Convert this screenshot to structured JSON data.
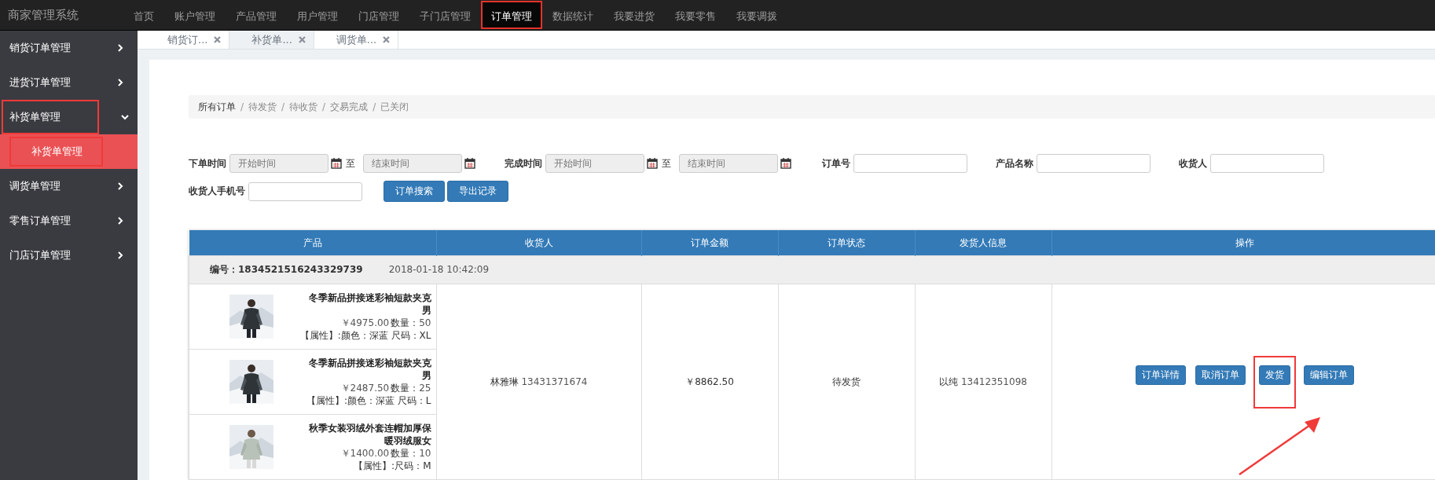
{
  "brand": "商家管理系统",
  "nav": [
    {
      "label": "首页",
      "selected": false,
      "highlighted": false
    },
    {
      "label": "账户管理",
      "selected": false,
      "highlighted": false
    },
    {
      "label": "产品管理",
      "selected": false,
      "highlighted": false
    },
    {
      "label": "用户管理",
      "selected": false,
      "highlighted": false
    },
    {
      "label": "门店管理",
      "selected": false,
      "highlighted": false
    },
    {
      "label": "子门店管理",
      "selected": false,
      "highlighted": false
    },
    {
      "label": "订单管理",
      "selected": true,
      "highlighted": true
    },
    {
      "label": "数据统计",
      "selected": false,
      "highlighted": false
    },
    {
      "label": "我要进货",
      "selected": false,
      "highlighted": false
    },
    {
      "label": "我要零售",
      "selected": false,
      "highlighted": false
    },
    {
      "label": "我要调拨",
      "selected": false,
      "highlighted": false
    }
  ],
  "sidebar": {
    "items": [
      {
        "label": "销货订单管理",
        "expanded": false,
        "highlighted": false
      },
      {
        "label": "进货订单管理",
        "expanded": false,
        "highlighted": false
      },
      {
        "label": "补货单管理",
        "expanded": true,
        "highlighted": true,
        "children": [
          {
            "label": "补货单管理",
            "selected": true,
            "highlighted": true
          }
        ]
      },
      {
        "label": "调货单管理",
        "expanded": false,
        "highlighted": false
      },
      {
        "label": "零售订单管理",
        "expanded": false,
        "highlighted": false
      },
      {
        "label": "门店订单管理",
        "expanded": false,
        "highlighted": false
      }
    ]
  },
  "tabs": [
    {
      "label": "销货订...",
      "selected": false
    },
    {
      "label": "补货单...",
      "selected": true
    },
    {
      "label": "调货单...",
      "selected": false
    }
  ],
  "breadcrumb": [
    {
      "label": "所有订单",
      "selected": true
    },
    {
      "separator": "/",
      "label": "待发货",
      "selected": false
    },
    {
      "separator": "/",
      "label": "待收货",
      "selected": false
    },
    {
      "separator": "/",
      "label": "交易完成",
      "selected": false
    },
    {
      "separator": "/",
      "label": "已关闭",
      "selected": false
    }
  ],
  "filters": {
    "order_time": {
      "label": "下单时间",
      "start_placeholder": "开始时间",
      "to": "至",
      "end_placeholder": "结束时间"
    },
    "finish_time": {
      "label": "完成时间",
      "start_placeholder": "开始时间",
      "to": "至",
      "end_placeholder": "结束时间"
    },
    "order_no": {
      "label": "订单号"
    },
    "product_name": {
      "label": "产品名称"
    },
    "receiver": {
      "label": "收货人"
    },
    "receiver_phone": {
      "label": "收货人手机号"
    },
    "buttons": [
      "订单搜索",
      "导出记录"
    ]
  },
  "table": {
    "columns": [
      "产品",
      "收货人",
      "订单金额",
      "订单状态",
      "发货人信息",
      "操作"
    ],
    "orders": [
      {
        "number": "编号：1834521516243329739",
        "date": "2018-01-18 10:42:09",
        "products": [
          {
            "kind": "picture",
            "title": "冬季新品拼接迷彩袖短款夹克男",
            "price": "￥4975.00",
            "qty_label": "数量：",
            "qty": "50",
            "attrs": "【属性】:颜色：深蓝 尺码：XL"
          },
          {
            "kind": "picture",
            "title": "冬季新品拼接迷彩袖短款夹克男",
            "price": "￥2487.50",
            "qty_label": "数量：",
            "qty": "25",
            "attrs": "【属性】:颜色：深蓝 尺码：L"
          },
          {
            "kind": "picture",
            "title": "秋季女装羽绒外套连帽加厚保暖羽绒服女",
            "price": "￥1400.00",
            "qty_label": "数量：",
            "qty": "10",
            "attrs": "【属性】:尺码：M"
          }
        ],
        "receiver_name": "林雅琳",
        "receiver_phone": "13431371674",
        "amount": "￥8862.50",
        "status": "待发货",
        "sender_name": "以纯",
        "sender_phone": "13412351098",
        "actions": [
          {
            "label": "订单详情",
            "highlighted": false
          },
          {
            "label": "取消订单",
            "highlighted": false
          },
          {
            "label": "发货",
            "highlighted": true
          },
          {
            "label": "编辑订单",
            "highlighted": false
          }
        ]
      }
    ]
  },
  "annotations": [
    {
      "kind": "arrow"
    }
  ]
}
